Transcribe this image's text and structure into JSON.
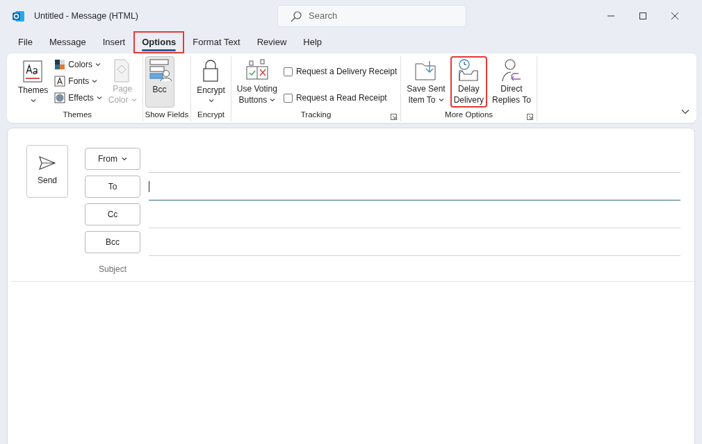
{
  "window": {
    "title": "Untitled  -  Message (HTML)"
  },
  "search": {
    "placeholder": "Search"
  },
  "tabs": [
    {
      "label": "File",
      "selected": false,
      "highlighted": false
    },
    {
      "label": "Message",
      "selected": false,
      "highlighted": false
    },
    {
      "label": "Insert",
      "selected": false,
      "highlighted": false
    },
    {
      "label": "Options",
      "selected": true,
      "highlighted": true
    },
    {
      "label": "Format Text",
      "selected": false,
      "highlighted": false
    },
    {
      "label": "Review",
      "selected": false,
      "highlighted": false
    },
    {
      "label": "Help",
      "selected": false,
      "highlighted": false
    }
  ],
  "ribbon_groups": [
    {
      "label": "Themes",
      "launcher": false,
      "items": [
        {
          "kind": "large",
          "lines": [
            "Themes"
          ],
          "dropdown": true,
          "disabled": false,
          "pressed": false,
          "highlighted": false
        },
        {
          "kind": "small",
          "lines": [
            "Colors"
          ],
          "dropdown": true,
          "disabled": false
        },
        {
          "kind": "small",
          "lines": [
            "Fonts"
          ],
          "dropdown": true,
          "disabled": false
        },
        {
          "kind": "small",
          "lines": [
            "Effects"
          ],
          "dropdown": true,
          "disabled": false
        },
        {
          "kind": "large",
          "lines": [
            "Page",
            "Color"
          ],
          "dropdown": true,
          "disabled": true,
          "pressed": false,
          "highlighted": false
        }
      ]
    },
    {
      "label": "Show Fields",
      "launcher": false,
      "items": [
        {
          "kind": "large",
          "lines": [
            "Bcc"
          ],
          "dropdown": false,
          "disabled": false,
          "pressed": true,
          "highlighted": false
        }
      ]
    },
    {
      "label": "Encrypt",
      "launcher": false,
      "items": [
        {
          "kind": "large",
          "lines": [
            "Encrypt"
          ],
          "dropdown": true,
          "disabled": false,
          "pressed": false,
          "highlighted": false
        }
      ]
    },
    {
      "label": "Tracking",
      "launcher": true,
      "items": [
        {
          "kind": "large",
          "lines": [
            "Use Voting",
            "Buttons"
          ],
          "dropdown": true,
          "disabled": false,
          "pressed": false,
          "highlighted": false
        },
        {
          "kind": "check",
          "lines": [
            "Request a Delivery Receipt"
          ],
          "checked": false
        },
        {
          "kind": "check",
          "lines": [
            "Request a Read Receipt"
          ],
          "checked": false
        }
      ]
    },
    {
      "label": "More Options",
      "launcher": true,
      "items": [
        {
          "kind": "large",
          "lines": [
            "Save Sent",
            "Item To"
          ],
          "dropdown": true,
          "disabled": false,
          "pressed": false,
          "highlighted": false
        },
        {
          "kind": "large",
          "lines": [
            "Delay",
            "Delivery"
          ],
          "dropdown": false,
          "disabled": false,
          "pressed": false,
          "highlighted": true
        },
        {
          "kind": "large",
          "lines": [
            "Direct",
            "Replies To"
          ],
          "dropdown": false,
          "disabled": false,
          "pressed": false,
          "highlighted": false
        }
      ]
    }
  ],
  "compose": {
    "send": {
      "label": "Send"
    },
    "fields": [
      {
        "label": "From",
        "kind": "dropdown",
        "focused": false
      },
      {
        "label": "To",
        "kind": "button",
        "focused": true
      },
      {
        "label": "Cc",
        "kind": "button",
        "focused": false
      },
      {
        "label": "Bcc",
        "kind": "button",
        "focused": false
      }
    ],
    "subject": {
      "label": "Subject"
    }
  }
}
